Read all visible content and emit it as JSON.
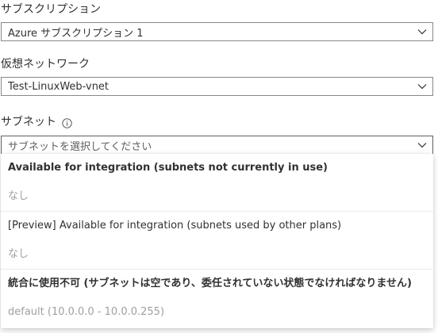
{
  "subscription": {
    "label": "サブスクリプション",
    "value": "Azure サブスクリプション 1"
  },
  "vnet": {
    "label": "仮想ネットワーク",
    "value": "Test-LinuxWeb-vnet"
  },
  "subnet": {
    "label": "サブネット",
    "placeholder": "サブネットを選択してください",
    "dropdown": {
      "groups": [
        {
          "header": "Available for integration (subnets not currently in use)",
          "items": [
            "なし"
          ]
        },
        {
          "header": "[Preview] Available for integration (subnets used by other plans)",
          "items": [
            "なし"
          ]
        },
        {
          "header": "統合に使用不可 (サブネットは空であり、委任されていない状態でなければなりません)",
          "items": [
            "default (10.0.0.0 - 10.0.0.255)"
          ]
        }
      ]
    }
  },
  "colors": {
    "text": "#323130",
    "border": "#8a8886",
    "disabled_text": "#a19f9d",
    "divider": "#edebe9"
  },
  "icons": {
    "chevron": "chevron-down-icon",
    "info": "info-icon"
  }
}
